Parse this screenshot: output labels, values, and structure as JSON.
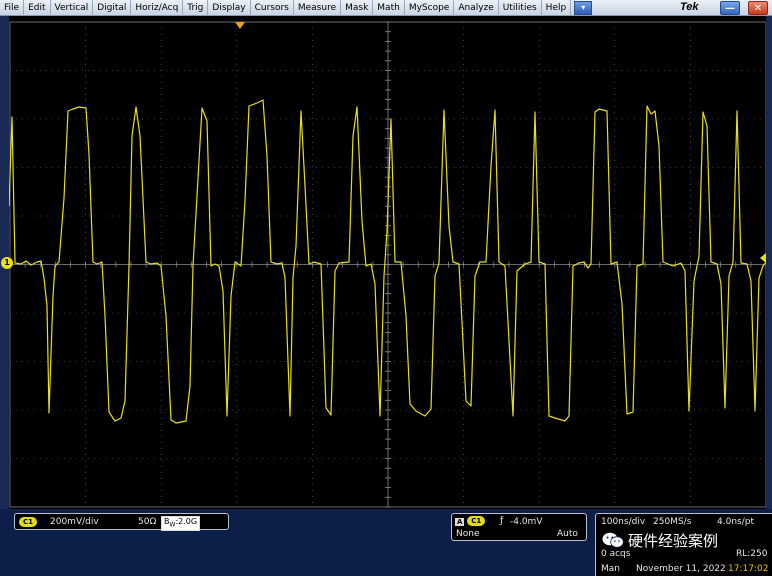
{
  "menu": {
    "items": [
      "File",
      "Edit",
      "Vertical",
      "Digital",
      "Horiz/Acq",
      "Trig",
      "Display",
      "Cursors",
      "Measure",
      "Mask",
      "Math",
      "MyScope",
      "Analyze",
      "Utilities",
      "Help"
    ],
    "dropdown_icon": "chevron-down-icon",
    "brand": "Tek"
  },
  "colors": {
    "trace": "#e8e01c",
    "grid": "#6a6a6a",
    "background": "#000000"
  },
  "channel": {
    "marker": "1"
  },
  "status": {
    "ch_badge": "C1",
    "volts_per_div": "200mV/div",
    "impedance": "50Ω",
    "bw_sub": "W",
    "bw_value": ":2.0G",
    "trigger_source_label": "A",
    "trigger_badge": "C1",
    "trigger_level": "-4.0mV",
    "trigger_coupling": "None",
    "trigger_mode": "Auto",
    "timebase": "100ns/div",
    "sample_rate": "250MS/s",
    "resolution": "4.0ns/pt",
    "acqs": "0 acqs",
    "record_length": "RL:250",
    "run_mode": "Man",
    "date": "November 11, 2022",
    "time": "17:17:02"
  },
  "watermark": {
    "text": "硬件经验案例"
  }
}
